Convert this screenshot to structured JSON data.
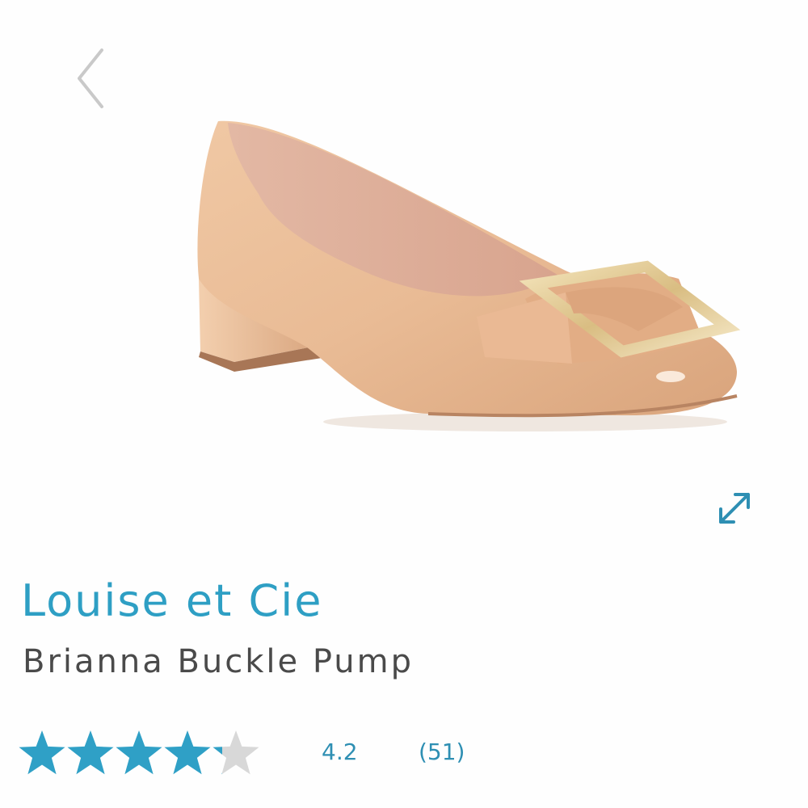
{
  "gallery": {
    "prev_icon": "chevron-left-icon",
    "expand_icon": "expand-diagonal-icon"
  },
  "product": {
    "brand": "Louise et Cie",
    "name": "Brianna Buckle Pump"
  },
  "rating": {
    "value": "4.2",
    "score": 4.2,
    "max": 5,
    "count_label": "(51)"
  },
  "colors": {
    "accent": "#2e9fc4",
    "star_filled": "#2fa0c6",
    "star_empty": "#d8d8d8",
    "text_dark": "#4a4a4a"
  }
}
